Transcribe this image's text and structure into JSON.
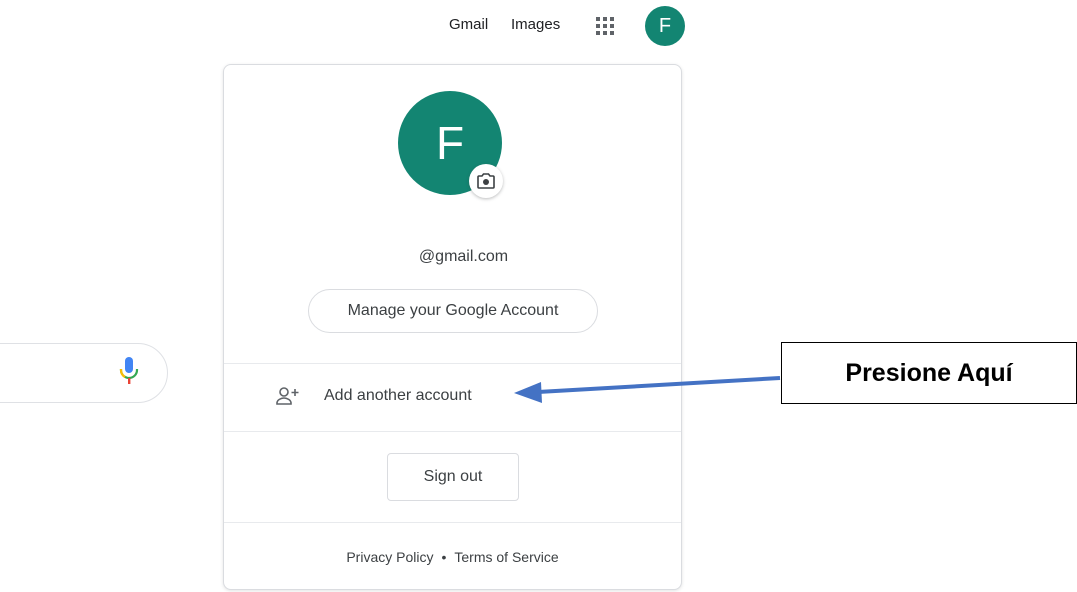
{
  "header": {
    "gmail_label": "Gmail",
    "images_label": "Images",
    "apps_icon": "apps-grid-icon",
    "avatar_initial": "F"
  },
  "search": {
    "mic_icon": "microphone-icon"
  },
  "account_card": {
    "avatar_initial": "F",
    "camera_icon": "camera-icon",
    "email": "@gmail.com",
    "manage_label": "Manage your Google Account",
    "add_account_icon": "person-add-icon",
    "add_account_label": "Add another account",
    "sign_out_label": "Sign out",
    "footer": {
      "privacy_label": "Privacy Policy",
      "separator": "•",
      "terms_label": "Terms of Service"
    }
  },
  "annotation": {
    "callout_text": "Presione Aquí"
  },
  "colors": {
    "avatar_bg": "#138572",
    "arrow": "#4472c4",
    "border": "#dadce0"
  }
}
